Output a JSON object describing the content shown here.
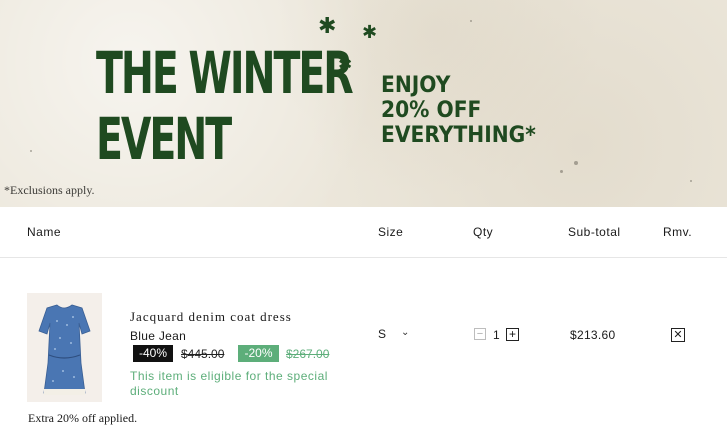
{
  "banner": {
    "headline": [
      "THE WINTER",
      "EVENT"
    ],
    "promo": [
      "ENJOY",
      "20% OFF",
      "EVERYTHING*"
    ],
    "exclusions": "*Exclusions apply."
  },
  "table": {
    "headers": [
      "Name",
      "Size",
      "Qty",
      "Sub-total",
      "Rmv."
    ]
  },
  "item": {
    "name": "Jacquard denim coat dress",
    "color": "Blue Jean",
    "discount_badge": "-40%",
    "original_price": "$445.00",
    "extra_badge": "-20%",
    "sale_price": "$267.00",
    "eligible_note": "This item is eligible for the special discount",
    "extra_note": "Extra 20% off applied.",
    "size": "S",
    "qty": "1",
    "subtotal": "$213.60"
  },
  "icons": {
    "star": "star-icon",
    "size_dropdown": "chevron-down-icon",
    "qty_minus": "minus-icon",
    "qty_plus": "plus-icon",
    "remove": "close-icon"
  },
  "colors": {
    "brand_green": "#1f4a20",
    "discount_green": "#5dae7a",
    "badge_black": "#111111"
  }
}
